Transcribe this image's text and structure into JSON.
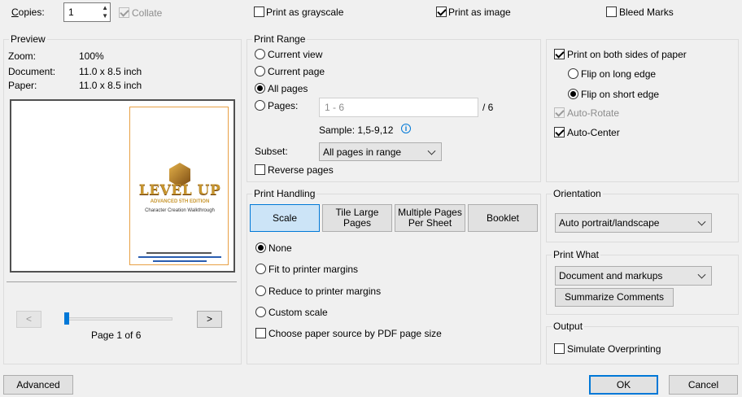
{
  "copies": {
    "label": "Copies:",
    "value": "1"
  },
  "collate": {
    "label": "Collate",
    "checked": true,
    "enabled": false
  },
  "grayscale": {
    "label": "Print as grayscale",
    "checked": false
  },
  "as_image": {
    "label": "Print as image",
    "checked": true
  },
  "bleed": {
    "label": "Bleed Marks",
    "checked": false
  },
  "preview": {
    "title": "Preview",
    "zoom_label": "Zoom:",
    "zoom_value": "100%",
    "document_label": "Document:",
    "document_value": "11.0 x 8.5 inch",
    "paper_label": "Paper:",
    "paper_value": "11.0 x 8.5 inch",
    "thumb_logo": "LEVEL UP",
    "thumb_subtitle": "ADVANCED 5TH EDITION",
    "thumb_caption": "Character Creation Walkthrough",
    "prev_label": "<",
    "next_label": ">",
    "page_text": "Page 1 of 6",
    "slider_position": 0
  },
  "print_range": {
    "title": "Print Range",
    "options": [
      "Current view",
      "Current page",
      "All pages",
      "Pages:"
    ],
    "selected": "All pages",
    "pages_value": "1 - 6",
    "pages_total": "/ 6",
    "sample": "Sample: 1,5-9,12",
    "subset_label": "Subset:",
    "subset_value": "All pages in range",
    "reverse_label": "Reverse pages"
  },
  "print_handling": {
    "title": "Print Handling",
    "tabs": [
      "Scale",
      "Tile Large Pages",
      "Multiple Pages Per Sheet",
      "Booklet"
    ],
    "selected_tab": "Scale",
    "scale_options": [
      "None",
      "Fit to printer margins",
      "Reduce to printer margins",
      "Custom scale"
    ],
    "scale_selected": "None",
    "paper_source_label": "Choose paper source by PDF page size"
  },
  "duplex": {
    "both_sides": "Print on both sides of paper",
    "flip_long": "Flip on long edge",
    "flip_short": "Flip on short edge",
    "flip_selected": "Flip on short edge",
    "auto_rotate": "Auto-Rotate",
    "auto_center": "Auto-Center"
  },
  "orientation": {
    "title": "Orientation",
    "value": "Auto portrait/landscape"
  },
  "print_what": {
    "title": "Print What",
    "value": "Document and markups",
    "summarize": "Summarize Comments"
  },
  "output": {
    "title": "Output",
    "simulate": "Simulate Overprinting"
  },
  "footer": {
    "advanced": "Advanced",
    "ok": "OK",
    "cancel": "Cancel"
  },
  "colors": {
    "accent": "#0078d7",
    "selected_tab": "#cce4f7",
    "logo_gold": "#c8962e"
  }
}
